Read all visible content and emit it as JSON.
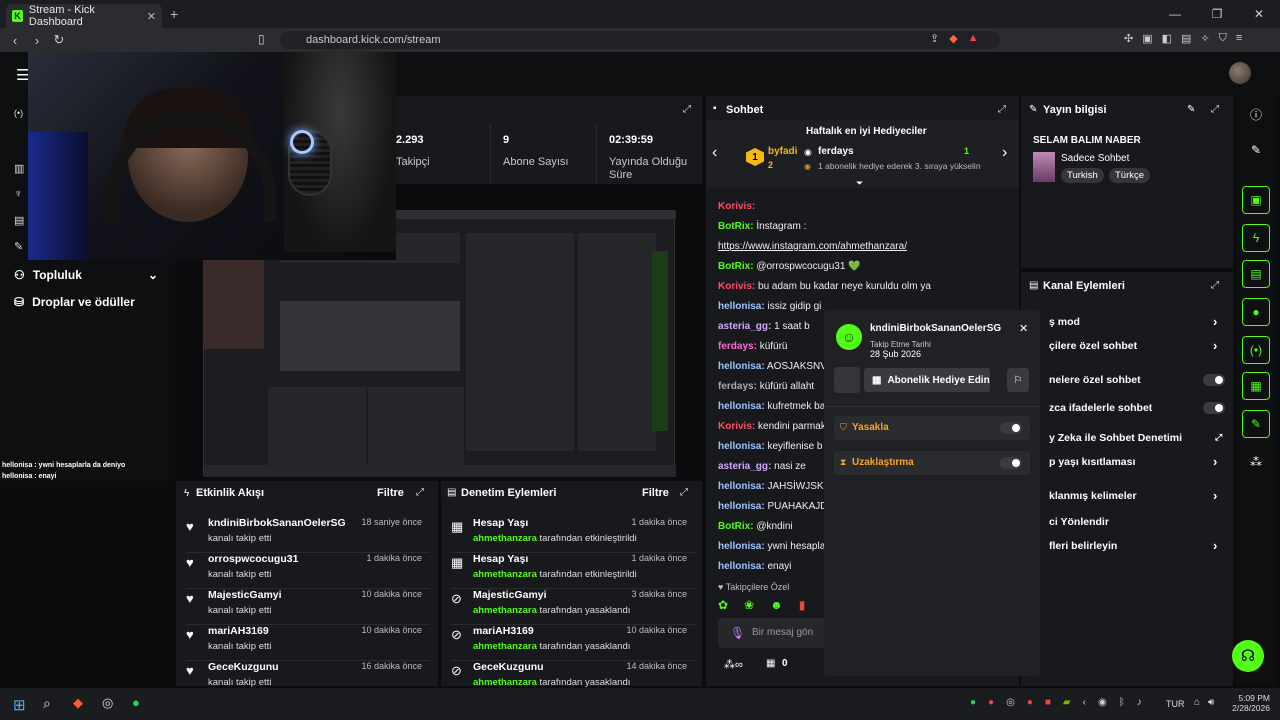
{
  "browser": {
    "tab_title": "Stream - Kick Dashboard",
    "url": "dashboard.kick.com/stream"
  },
  "sidebar": {
    "items": [
      {
        "label": "Topluluk"
      },
      {
        "label": "Droplar ve ödüller"
      }
    ]
  },
  "stats": [
    {
      "value": "2.293",
      "label": "Takipçi"
    },
    {
      "value": "9",
      "label": "Abone Sayısı"
    },
    {
      "value": "02:39:59",
      "label": "Yayında Olduğu Süre"
    }
  ],
  "overlay_chat": [
    "hellonisa : ywni hesaplarla da deniyo",
    "hellonisa : enayi"
  ],
  "activity": {
    "title": "Etkinlik Akışı",
    "filter": "Filtre",
    "items": [
      {
        "name": "kndiniBirbokSananOelerSG",
        "sub": "kanalı takip etti",
        "time": "18 saniye önce"
      },
      {
        "name": "orrospwcocugu31",
        "sub": "kanalı takip etti",
        "time": "1 dakika önce"
      },
      {
        "name": "MajesticGamyi",
        "sub": "kanalı takip etti",
        "time": "10 dakika önce"
      },
      {
        "name": "mariAH3169",
        "sub": "kanalı takip etti",
        "time": "10 dakika önce"
      },
      {
        "name": "GeceKuzgunu",
        "sub": "kanalı takip etti",
        "time": "16 dakika önce"
      }
    ]
  },
  "moderation": {
    "title": "Denetim Eylemleri",
    "filter": "Filtre",
    "items": [
      {
        "name": "Hesap Yaşı",
        "by": "ahmethanzara",
        "action": "tarafından etkinleştirildi",
        "time": "1 dakika önce"
      },
      {
        "name": "Hesap Yaşı",
        "by": "ahmethanzara",
        "action": "tarafından etkinleştirildi",
        "time": "1 dakika önce"
      },
      {
        "name": "MajesticGamyi",
        "by": "ahmethanzara",
        "action": "tarafından yasaklandı",
        "time": "3 dakika önce"
      },
      {
        "name": "mariAH3169",
        "by": "ahmethanzara",
        "action": "tarafından yasaklandı",
        "time": "10 dakika önce"
      },
      {
        "name": "GeceKuzgunu",
        "by": "ahmethanzara",
        "action": "tarafından yasaklandı",
        "time": "14 dakika önce"
      }
    ]
  },
  "chat": {
    "title": "Sohbet",
    "gifter_title": "Haftalık en iyi Hediyeciler",
    "gifter1": "byfadi",
    "gifter1_count": "2",
    "gifter2": "ferdays",
    "gifter2_count": "1",
    "gifter_note": "1 abonelik hediye ederek 3. sıraya yükselin",
    "messages": [
      {
        "user": "Korivis:",
        "text": "",
        "color": "#ff4d6a"
      },
      {
        "user": "BotRix:",
        "text": "İnstagram :",
        "color": "#53fc18"
      },
      {
        "user": "",
        "text": "https://www.instagram.com/ahmethanzara/",
        "color": "#fff"
      },
      {
        "user": "BotRix:",
        "text": "@orrospwcocugu31 💚",
        "color": "#53fc18"
      },
      {
        "user": "Korivis:",
        "text": "bu adam bu kadar neye kuruldu olm ya",
        "color": "#ff4d6a"
      },
      {
        "user": "hellonisa:",
        "text": "issiz gidip gi",
        "color": "#9ec5ff"
      },
      {
        "user": "asteria_gg:",
        "text": "1 saat b",
        "color": "#d4a8ff"
      },
      {
        "user": "ferdays:",
        "text": "küfürü",
        "color": "#ff6ad5"
      },
      {
        "user": "hellonisa:",
        "text": "AOSJAKSNV",
        "color": "#9ec5ff"
      },
      {
        "user": "ferdays:",
        "text": "küfürü allaht",
        "color": "#aaa"
      },
      {
        "user": "hellonisa:",
        "text": "kufretmek ba",
        "color": "#9ec5ff"
      },
      {
        "user": "Korivis:",
        "text": "kendini parmak",
        "color": "#ff4d6a"
      },
      {
        "user": "hellonisa:",
        "text": "keyiflenise b",
        "color": "#9ec5ff"
      },
      {
        "user": "asteria_gg:",
        "text": "nasi ze",
        "color": "#d4a8ff"
      },
      {
        "user": "hellonisa:",
        "text": "JAHSİWJSK",
        "color": "#9ec5ff"
      },
      {
        "user": "hellonisa:",
        "text": "PUAHAKAJD",
        "color": "#9ec5ff"
      },
      {
        "user": "BotRix:",
        "text": "@kndini",
        "color": "#53fc18"
      },
      {
        "user": "hellonisa:",
        "text": "ywni hesapla",
        "color": "#9ec5ff"
      },
      {
        "user": "hellonisa:",
        "text": "enayi",
        "color": "#9ec5ff"
      }
    ],
    "followers_only": "Takipçilere Özel",
    "input_placeholder": "Bir mesaj gön",
    "footer_count": "0"
  },
  "stream_info": {
    "title": "Yayın bilgisi",
    "stream_title": "SELAM BALIM NABER",
    "category": "Sadece Sohbet",
    "tags": [
      "Turkish",
      "Türkçe"
    ]
  },
  "channel_actions": {
    "title": "Kanal Eylemleri",
    "rows": [
      "ş mod",
      "çilere özel sohbet",
      "nelere özel sohbet",
      "zca ifadelerle sohbet",
      "y Zeka ile Sohbet Denetimi",
      "p yaşı kısıtlaması",
      "klanmış kelimeler",
      "ci Yönlendir",
      "fleri belirleyin"
    ]
  },
  "popup": {
    "username": "kndiniBirbokSananOelerSG",
    "follow_label": "Takip Etme Tarihi",
    "follow_date": "28 Şub 2026",
    "gift_button": "Abonelik Hediye Edin",
    "ban": "Yasakla",
    "timeout": "Uzaklaştırma"
  },
  "taskbar": {
    "lang": "TUR",
    "time": "5:09 PM",
    "date": "2/28/2026"
  },
  "colors": {
    "accent": "#53fc18",
    "panel": "#18191c",
    "bg": "#0b0c0e"
  }
}
